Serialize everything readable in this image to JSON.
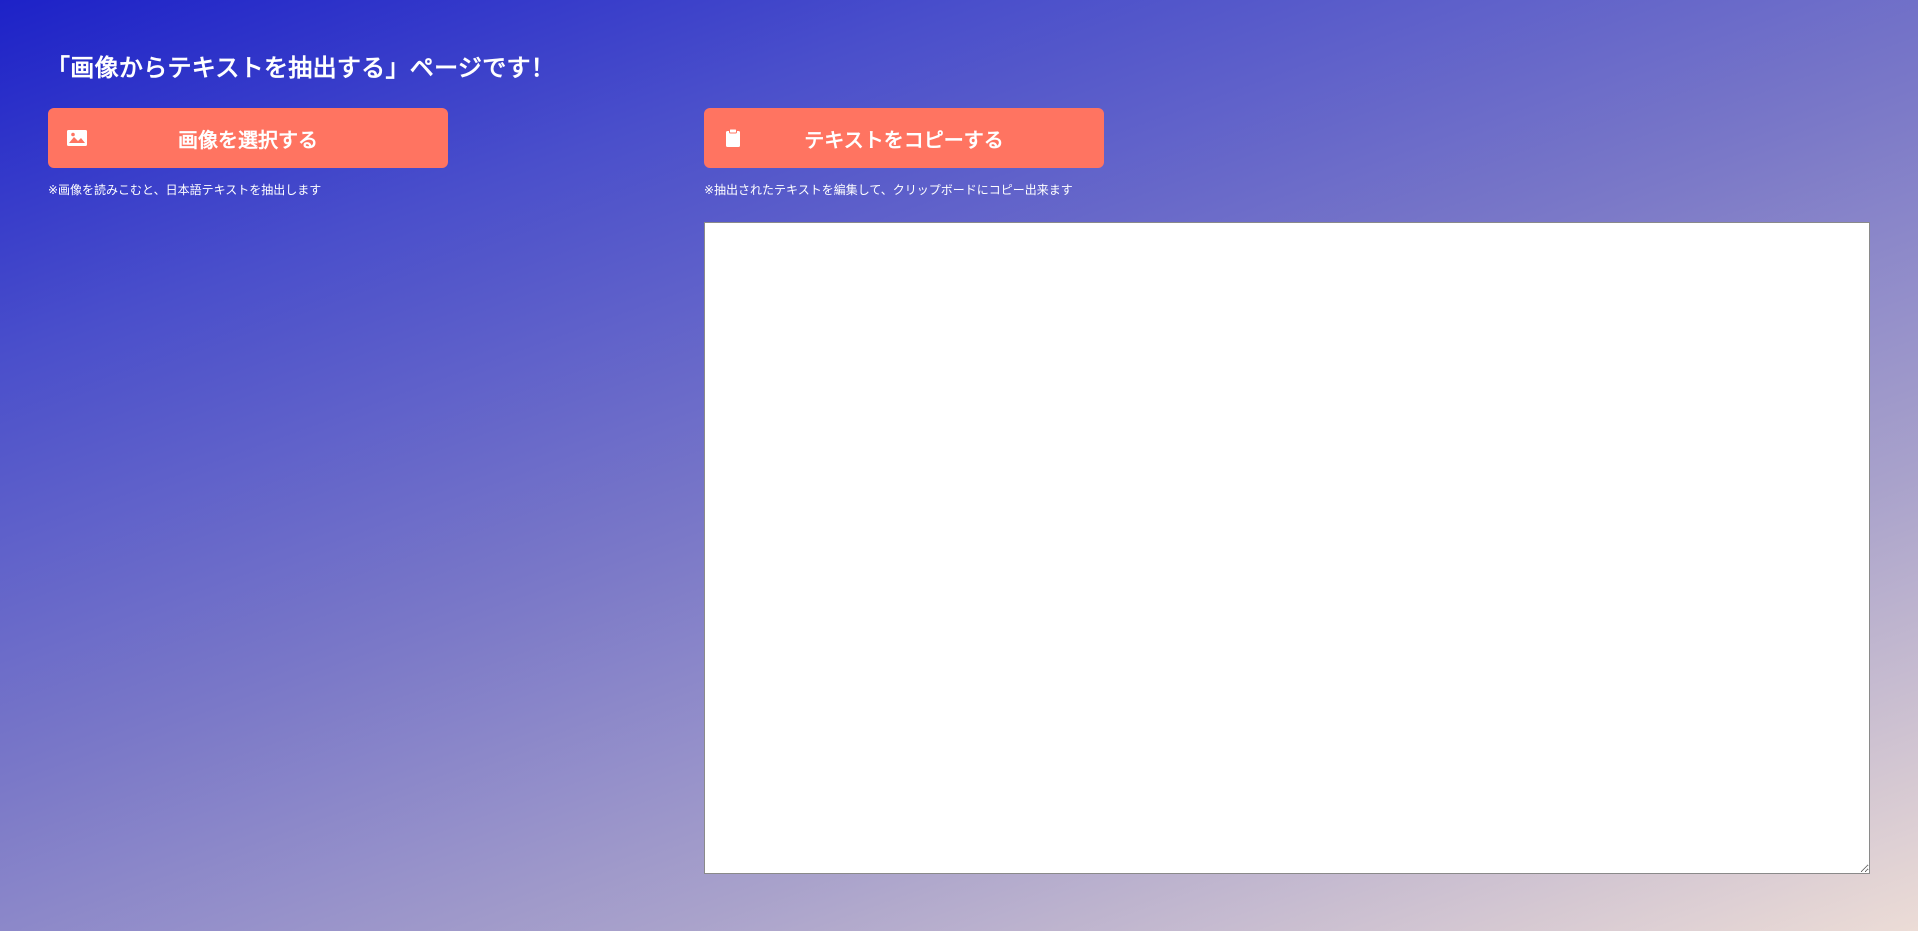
{
  "header": {
    "title": "「画像からテキストを抽出する」ページです！"
  },
  "left_panel": {
    "select_button_label": "画像を選択する",
    "select_button_icon": "image-icon",
    "note": "※画像を読みこむと、日本語テキストを抽出します"
  },
  "right_panel": {
    "copy_button_label": "テキストをコピーする",
    "copy_button_icon": "clipboard-icon",
    "note": "※抽出されたテキストを編集して、クリップボードにコピー出来ます",
    "textarea_value": ""
  },
  "colors": {
    "button": "#ff7461",
    "gradient_start": "#1d22c8",
    "gradient_end": "#ecdcd6"
  }
}
